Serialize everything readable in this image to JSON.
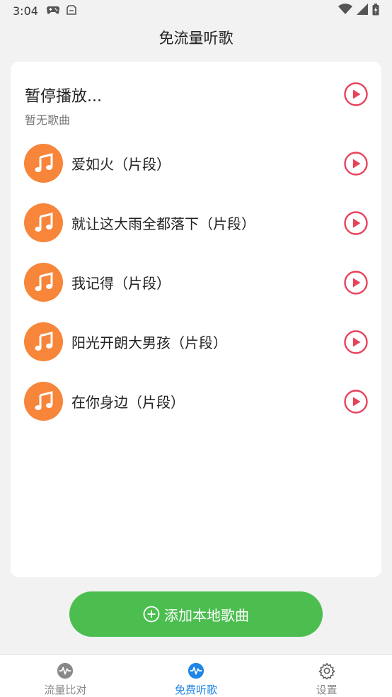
{
  "status_bar": {
    "time": "3:04",
    "left_icons": [
      "gamepad-icon",
      "clipboard-icon"
    ],
    "right_icons": [
      "wifi-icon",
      "signal-icon",
      "battery-icon"
    ]
  },
  "app": {
    "title": "免流量听歌"
  },
  "now_playing": {
    "title": "暂停播放...",
    "subtitle": "暂无歌曲"
  },
  "songs": [
    {
      "title": "爱如火（片段）"
    },
    {
      "title": "就让这大雨全都落下（片段）"
    },
    {
      "title": "我记得（片段）"
    },
    {
      "title": "阳光开朗大男孩（片段）"
    },
    {
      "title": "在你身边（片段）"
    }
  ],
  "add_button": {
    "label": "添加本地歌曲"
  },
  "bottom_nav": {
    "items": [
      {
        "label": "流量比对",
        "icon": "waveform-icon",
        "active": false
      },
      {
        "label": "免费听歌",
        "icon": "waveform-icon",
        "active": true
      },
      {
        "label": "设置",
        "icon": "gear-icon",
        "active": false
      }
    ]
  },
  "colors": {
    "accent_green": "#4cbe50",
    "song_icon_orange": "#f7853a",
    "play_red": "#e8425a",
    "nav_active_blue": "#1f86e6",
    "nav_inactive_gray": "#888888"
  }
}
